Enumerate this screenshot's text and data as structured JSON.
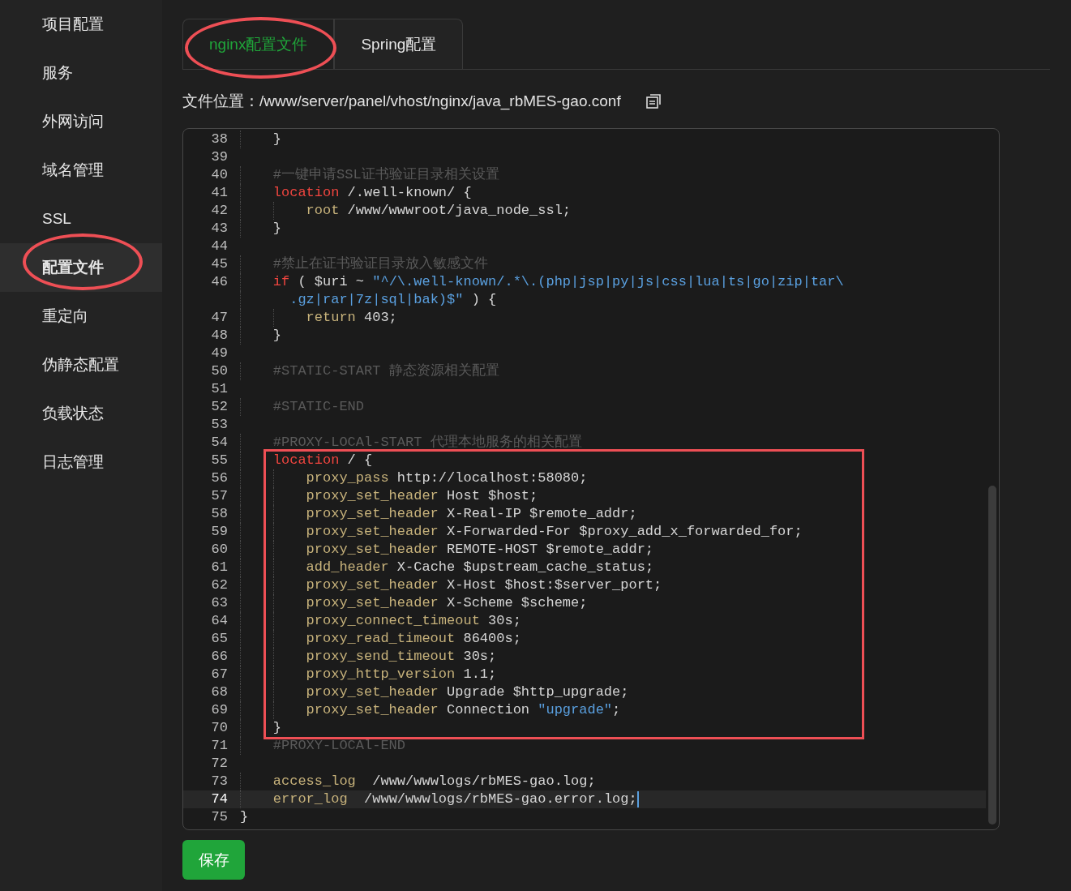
{
  "sidebar": {
    "items": [
      {
        "label": "项目配置",
        "selected": false,
        "circled": false
      },
      {
        "label": "服务",
        "selected": false,
        "circled": false
      },
      {
        "label": "外网访问",
        "selected": false,
        "circled": false
      },
      {
        "label": "域名管理",
        "selected": false,
        "circled": false
      },
      {
        "label": "SSL",
        "selected": false,
        "circled": false
      },
      {
        "label": "配置文件",
        "selected": true,
        "circled": true
      },
      {
        "label": "重定向",
        "selected": false,
        "circled": false
      },
      {
        "label": "伪静态配置",
        "selected": false,
        "circled": false
      },
      {
        "label": "负载状态",
        "selected": false,
        "circled": false
      },
      {
        "label": "日志管理",
        "selected": false,
        "circled": false
      }
    ]
  },
  "tabs": [
    {
      "label": "nginx配置文件",
      "selected": true,
      "circled": true
    },
    {
      "label": "Spring配置",
      "selected": false,
      "circled": false
    }
  ],
  "file_location": {
    "label": "文件位置：",
    "path": "/www/server/panel/vhost/nginx/java_rbMES-gao.conf"
  },
  "editor": {
    "sections": [
      {
        "boxed": false,
        "lines": [
          {
            "number": "38",
            "current": false,
            "tokens": [
              {
                "kind": "text",
                "text": "    }"
              }
            ]
          },
          {
            "number": "39",
            "current": false
          },
          {
            "number": "40",
            "current": false,
            "tokens": [
              {
                "kind": "comment",
                "text": "    #一键申请SSL证书验证目录相关设置"
              }
            ]
          },
          {
            "number": "41",
            "current": false,
            "tokens": [
              {
                "kind": "keyword",
                "text": "    location"
              },
              {
                "kind": "text",
                "text": " /.well-known/ {"
              }
            ]
          },
          {
            "number": "42",
            "current": false,
            "tokens": [
              {
                "kind": "directive",
                "text": "        root"
              },
              {
                "kind": "text",
                "text": " /www/wwwroot/java_node_ssl;"
              }
            ]
          },
          {
            "number": "43",
            "current": false,
            "tokens": [
              {
                "kind": "text",
                "text": "    }"
              }
            ]
          },
          {
            "number": "44",
            "current": false
          },
          {
            "number": "45",
            "current": false,
            "tokens": [
              {
                "kind": "comment",
                "text": "    #禁止在证书验证目录放入敏感文件"
              }
            ]
          },
          {
            "number": "46",
            "current": false,
            "tokens": [
              {
                "kind": "keyword",
                "text": "    if"
              },
              {
                "kind": "text",
                "text": " ( $uri ~ "
              },
              {
                "kind": "string",
                "text": "\"^/\\.well-known/.*\\.(php|jsp|py|js|css|lua|ts|go|zip|tar\\"
              }
            ]
          },
          {
            "current": false,
            "tokens": [
              {
                "kind": "string",
                "text": "      .gz|rar|7z|sql|bak)$\""
              },
              {
                "kind": "text",
                "text": " ) {"
              }
            ]
          },
          {
            "number": "47",
            "current": false,
            "tokens": [
              {
                "kind": "directive",
                "text": "        return"
              },
              {
                "kind": "text",
                "text": " 403;"
              }
            ]
          },
          {
            "number": "48",
            "current": false,
            "tokens": [
              {
                "kind": "text",
                "text": "    }"
              }
            ]
          },
          {
            "number": "49",
            "current": false
          },
          {
            "number": "50",
            "current": false,
            "tokens": [
              {
                "kind": "comment",
                "text": "    #STATIC-START 静态资源相关配置"
              }
            ]
          },
          {
            "number": "51",
            "current": false
          },
          {
            "number": "52",
            "current": false,
            "tokens": [
              {
                "kind": "comment",
                "text": "    #STATIC-END"
              }
            ]
          },
          {
            "number": "53",
            "current": false
          },
          {
            "number": "54",
            "current": false,
            "tokens": [
              {
                "kind": "comment",
                "text": "    #PROXY-LOCAl-START 代理本地服务的相关配置"
              }
            ]
          }
        ]
      },
      {
        "boxed": true,
        "lines": [
          {
            "number": "55",
            "current": false,
            "tokens": [
              {
                "kind": "keyword",
                "text": "    location"
              },
              {
                "kind": "text",
                "text": " / {"
              }
            ]
          },
          {
            "number": "56",
            "current": false,
            "tokens": [
              {
                "kind": "directive",
                "text": "        proxy_pass"
              },
              {
                "kind": "text",
                "text": " http://localhost:58080;"
              }
            ]
          },
          {
            "number": "57",
            "current": false,
            "tokens": [
              {
                "kind": "directive",
                "text": "        proxy_set_header"
              },
              {
                "kind": "text",
                "text": " Host $host;"
              }
            ]
          },
          {
            "number": "58",
            "current": false,
            "tokens": [
              {
                "kind": "directive",
                "text": "        proxy_set_header"
              },
              {
                "kind": "text",
                "text": " X-Real-IP $remote_addr;"
              }
            ]
          },
          {
            "number": "59",
            "current": false,
            "tokens": [
              {
                "kind": "directive",
                "text": "        proxy_set_header"
              },
              {
                "kind": "text",
                "text": " X-Forwarded-For $proxy_add_x_forwarded_for;"
              }
            ]
          },
          {
            "number": "60",
            "current": false,
            "tokens": [
              {
                "kind": "directive",
                "text": "        proxy_set_header"
              },
              {
                "kind": "text",
                "text": " REMOTE-HOST $remote_addr;"
              }
            ]
          },
          {
            "number": "61",
            "current": false,
            "tokens": [
              {
                "kind": "directive",
                "text": "        add_header"
              },
              {
                "kind": "text",
                "text": " X-Cache $upstream_cache_status;"
              }
            ]
          },
          {
            "number": "62",
            "current": false,
            "tokens": [
              {
                "kind": "directive",
                "text": "        proxy_set_header"
              },
              {
                "kind": "text",
                "text": " X-Host $host:$server_port;"
              }
            ]
          },
          {
            "number": "63",
            "current": false,
            "tokens": [
              {
                "kind": "directive",
                "text": "        proxy_set_header"
              },
              {
                "kind": "text",
                "text": " X-Scheme $scheme;"
              }
            ]
          },
          {
            "number": "64",
            "current": false,
            "tokens": [
              {
                "kind": "directive",
                "text": "        proxy_connect_timeout"
              },
              {
                "kind": "text",
                "text": " 30s;"
              }
            ]
          },
          {
            "number": "65",
            "current": false,
            "tokens": [
              {
                "kind": "directive",
                "text": "        proxy_read_timeout"
              },
              {
                "kind": "text",
                "text": " 86400s;"
              }
            ]
          },
          {
            "number": "66",
            "current": false,
            "tokens": [
              {
                "kind": "directive",
                "text": "        proxy_send_timeout"
              },
              {
                "kind": "text",
                "text": " 30s;"
              }
            ]
          },
          {
            "number": "67",
            "current": false,
            "tokens": [
              {
                "kind": "directive",
                "text": "        proxy_http_version"
              },
              {
                "kind": "text",
                "text": " 1.1;"
              }
            ]
          },
          {
            "number": "68",
            "current": false,
            "tokens": [
              {
                "kind": "directive",
                "text": "        proxy_set_header"
              },
              {
                "kind": "text",
                "text": " Upgrade $http_upgrade;"
              }
            ]
          },
          {
            "number": "69",
            "current": false,
            "tokens": [
              {
                "kind": "directive",
                "text": "        proxy_set_header"
              },
              {
                "kind": "text",
                "text": " Connection "
              },
              {
                "kind": "string",
                "text": "\"upgrade\""
              },
              {
                "kind": "text",
                "text": ";"
              }
            ]
          },
          {
            "number": "70",
            "current": false,
            "tokens": [
              {
                "kind": "text",
                "text": "    }"
              }
            ]
          }
        ]
      },
      {
        "boxed": false,
        "lines": [
          {
            "number": "71",
            "current": false,
            "tokens": [
              {
                "kind": "comment",
                "text": "    #PROXY-LOCAl-END"
              }
            ]
          },
          {
            "number": "72",
            "current": false
          },
          {
            "number": "73",
            "current": false,
            "tokens": [
              {
                "kind": "directive",
                "text": "    access_log"
              },
              {
                "kind": "text",
                "text": "  /www/wwwlogs/rbMES-gao.log;"
              }
            ]
          },
          {
            "number": "74",
            "current": true,
            "tokens": [
              {
                "kind": "directive",
                "text": "    error_log"
              },
              {
                "kind": "text",
                "text": "  /www/wwwlogs/rbMES-gao.error.log;"
              }
            ]
          },
          {
            "number": "75",
            "current": false,
            "tokens": [
              {
                "kind": "text",
                "text": "}"
              }
            ]
          }
        ]
      }
    ]
  },
  "save_button": {
    "label": "保存"
  }
}
